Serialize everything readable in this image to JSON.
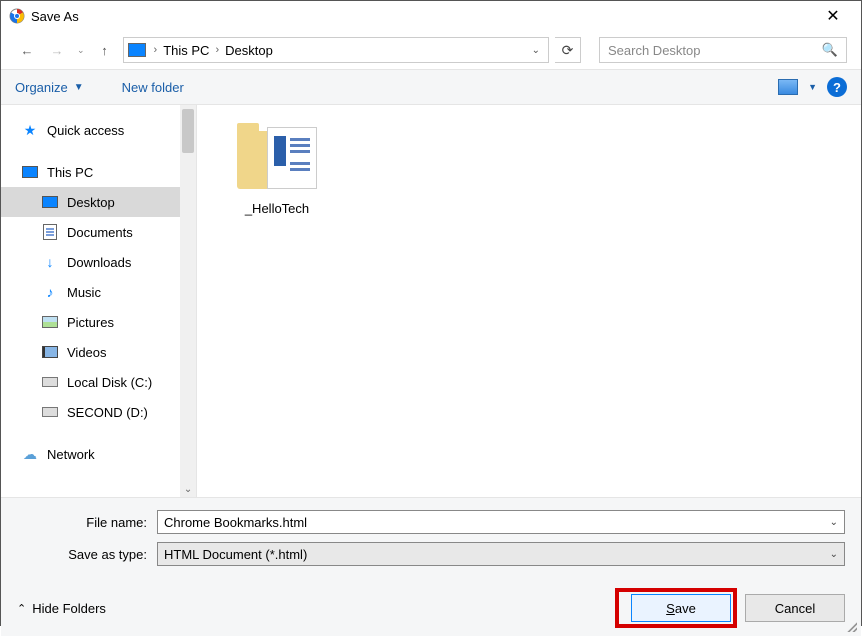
{
  "window": {
    "title": "Save As"
  },
  "breadcrumb": {
    "pc": "This PC",
    "loc": "Desktop"
  },
  "search": {
    "placeholder": "Search Desktop"
  },
  "toolbar": {
    "organize": "Organize",
    "newfolder": "New folder"
  },
  "tree": {
    "quick": "Quick access",
    "thispc": "This PC",
    "desktop": "Desktop",
    "documents": "Documents",
    "downloads": "Downloads",
    "music": "Music",
    "pictures": "Pictures",
    "videos": "Videos",
    "localdisk": "Local Disk (C:)",
    "second": "SECOND (D:)",
    "network": "Network"
  },
  "files": {
    "folder1": "_HelloTech"
  },
  "form": {
    "filename_label": "File name:",
    "filename_value": "Chrome Bookmarks.html",
    "type_label": "Save as type:",
    "type_value": "HTML Document (*.html)"
  },
  "buttons": {
    "hide": "Hide Folders",
    "save_pre": "",
    "save_key": "S",
    "save_post": "ave",
    "cancel": "Cancel"
  }
}
